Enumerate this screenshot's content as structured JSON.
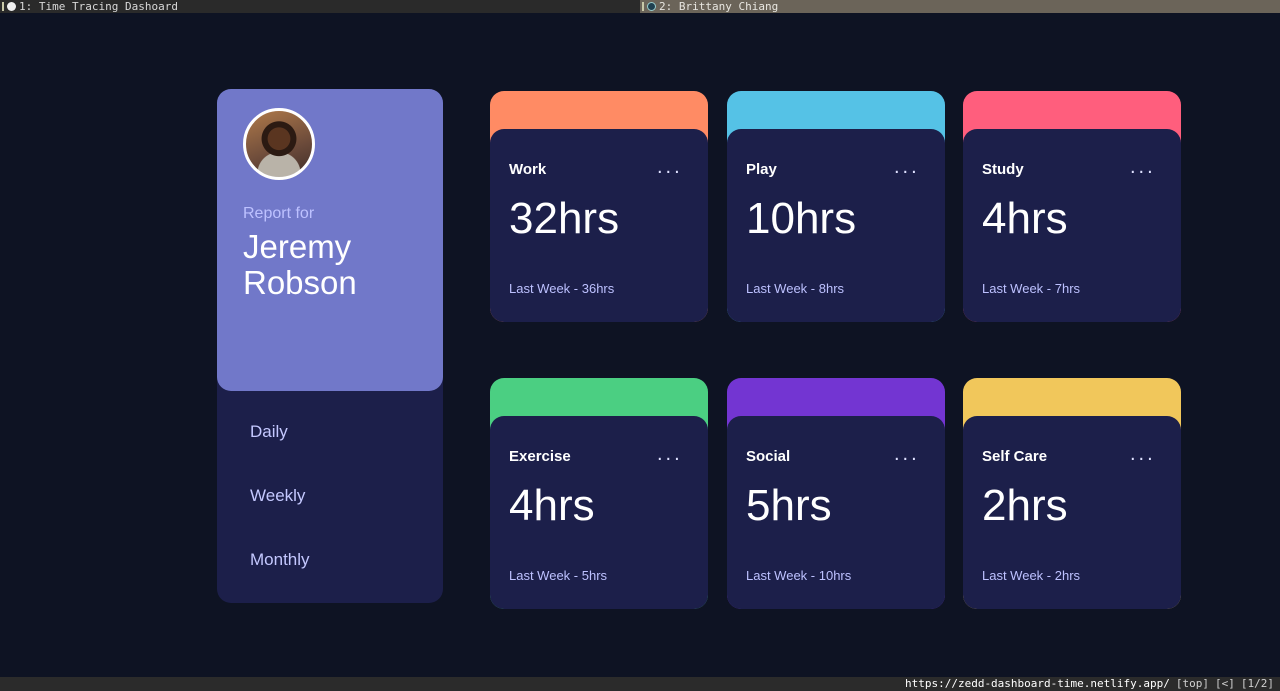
{
  "browser": {
    "tabs": [
      {
        "label": "1: Time Tracing Dashoard"
      },
      {
        "label": "2: Brittany Chiang"
      }
    ],
    "status": {
      "url": "https://zedd-dashboard-time.netlify.app/",
      "position": "[top]",
      "nav": "[<]",
      "pages": "[1/2]"
    }
  },
  "profile": {
    "report_for": "Report for",
    "name": "Jeremy Robson",
    "timeframes": [
      "Daily",
      "Weekly",
      "Monthly"
    ]
  },
  "activities": [
    {
      "title": "Work",
      "hours": "32hrs",
      "previous": "Last Week - 36hrs",
      "color": "#ff8b64",
      "menu": "..."
    },
    {
      "title": "Play",
      "hours": "10hrs",
      "previous": "Last Week - 8hrs",
      "color": "#55c2e6",
      "menu": "..."
    },
    {
      "title": "Study",
      "hours": "4hrs",
      "previous": "Last Week - 7hrs",
      "color": "#ff5e7d",
      "menu": "..."
    },
    {
      "title": "Exercise",
      "hours": "4hrs",
      "previous": "Last Week - 5hrs",
      "color": "#4bcf82",
      "menu": "..."
    },
    {
      "title": "Social",
      "hours": "5hrs",
      "previous": "Last Week - 10hrs",
      "color": "#7335d2",
      "menu": "..."
    },
    {
      "title": "Self Care",
      "hours": "2hrs",
      "previous": "Last Week - 2hrs",
      "color": "#f1c75b",
      "menu": "..."
    }
  ]
}
